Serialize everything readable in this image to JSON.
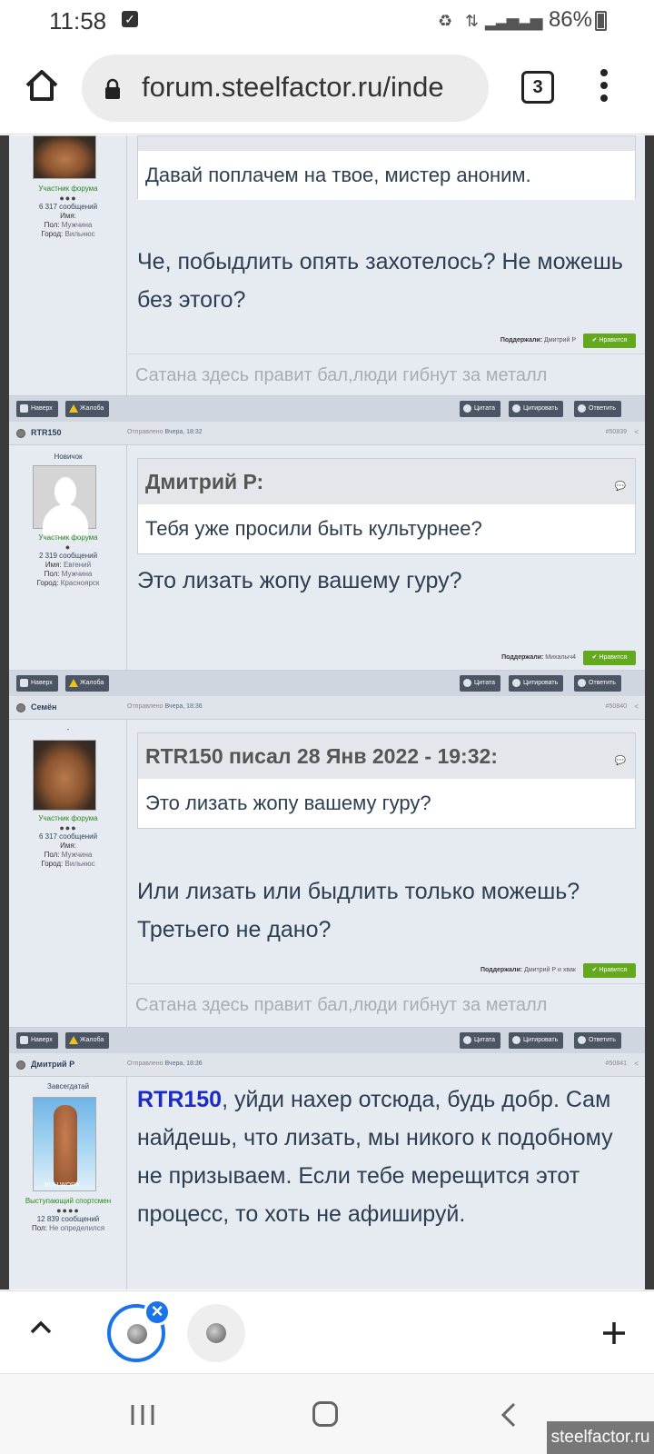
{
  "status_bar": {
    "time": "11:58",
    "battery": "86%"
  },
  "browser": {
    "url": "forum.steelfactor.ru/inde",
    "tab_count": "3"
  },
  "posts": [
    {
      "user": {
        "role": "Участник форума",
        "rank_dots": "●●●",
        "messages": "6 317 сообщений",
        "name_label": "Имя:",
        "name_value": "",
        "gender_label": "Пол:",
        "gender_value": "Мужчина",
        "city_label": "Город:",
        "city_value": "Вильнюс"
      },
      "quote_text": "Давай поплачем на твое, мистер аноним.",
      "text": "Че, побыдлить опять захотелось? Не можешь без этого?",
      "supported_label": "Поддержали:",
      "supported_by": "Дмитрий Р",
      "like_label": "Нравится",
      "signature": "Сатана здесь правит бал,люди гибнут за металл"
    },
    {
      "author": "RTR150",
      "time_label": "Отправлено",
      "time_value": "Вчера, 18:32",
      "post_number": "#50839",
      "user": {
        "status": "Новичок",
        "role": "Участник форума",
        "rank_dots": "●",
        "messages": "2 319 сообщений",
        "name_label": "Имя:",
        "name_value": "Евгений",
        "gender_label": "Пол:",
        "gender_value": "Мужчина",
        "city_label": "Город:",
        "city_value": "Красноярск"
      },
      "quote_author": "Дмитрий Р:",
      "quote_text": "Тебя уже просили быть культурнее?",
      "text": "Это лизать жопу вашему гуру?",
      "supported_label": "Поддержали:",
      "supported_by": "Михалыч4",
      "like_label": "Нравится"
    },
    {
      "author": "Семён",
      "time_label": "Отправлено",
      "time_value": "Вчера, 18:36",
      "post_number": "#50840",
      "user": {
        "status": "-",
        "role": "Участник форума",
        "rank_dots": "●●●",
        "messages": "6 317 сообщений",
        "name_label": "Имя:",
        "name_value": "",
        "gender_label": "Пол:",
        "gender_value": "Мужчина",
        "city_label": "Город:",
        "city_value": "Вильнюс"
      },
      "quote_author": "RTR150 писал 28 Янв 2022 - 19:32:",
      "quote_text": "Это лизать жопу вашему гуру?",
      "text": "Или лизать или быдлить только можешь? Третьего не дано?",
      "supported_label": "Поддержали:",
      "supported_by": "Дмитрий Р и хвак",
      "like_label": "Нравится",
      "signature": "Сатана здесь правит бал,люди гибнут за металл"
    },
    {
      "author": "Дмитрий Р",
      "time_label": "Отправлено",
      "time_value": "Вчера, 18:36",
      "post_number": "#50841",
      "user": {
        "status": "Завсегдатай",
        "avatar_brand": "BULLWORX",
        "role": "Выступающий спортсмен",
        "rank_dots": "●●●●",
        "messages": "12 839 сообщений",
        "gender_label": "Пол:",
        "gender_value": "Не определился"
      },
      "mention": "RTR150",
      "text": ", уйди нахер отсюда, будь добр. Сам найдешь, что лизать, мы никого к подобному не призываем. Если тебе мерещится этот процесс, то хоть не афишируй."
    }
  ],
  "actions": {
    "top": "Наверх",
    "report": "Жалоба",
    "quote": "Цитата",
    "multiquote": "Цитировать",
    "reply": "Ответить"
  },
  "watermark": "steelfactor.ru",
  "colors": {
    "accent": "#1a73e8",
    "like_green": "#63a81f",
    "mention_blue": "#1a2cc4",
    "action_button": "#4b5563"
  }
}
